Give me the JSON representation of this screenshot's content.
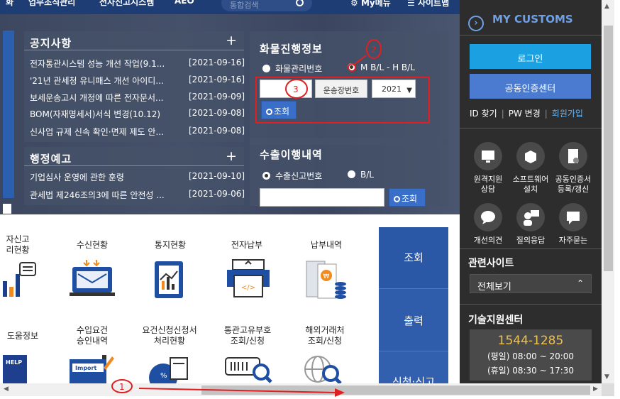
{
  "topnav": {
    "item1": "화",
    "item2": "업무조직관리",
    "item3": "전자신고시스템",
    "item4": "AEO",
    "search_placeholder": "통합검색",
    "mymenu": "My메뉴",
    "sitemap": "사이트맵"
  },
  "notice": {
    "title": "공지사항",
    "items": [
      {
        "title": "전자통관시스템 성능 개선 작업(9.1...",
        "date": "[2021-09-16]"
      },
      {
        "title": "'21년 관세청 유니패스 개선 아이디...",
        "date": "[2021-09-16]"
      },
      {
        "title": "보세운송고시 개정에 따른 전자문서...",
        "date": "[2021-09-09]"
      },
      {
        "title": "BOM(자재명세서)서식 변경(10.12)",
        "date": "[2021-09-08]"
      },
      {
        "title": "신사업 규제 신속 확인·면제 제도 안...",
        "date": "[2021-09-08]"
      }
    ]
  },
  "admin": {
    "title": "행정예고",
    "items": [
      {
        "title": "기업심사 운영에 관한 훈령",
        "date": "[2021-09-10]"
      },
      {
        "title": "관세법 제246조의3에 따른 안전성 ...",
        "date": "[2021-09-06]"
      }
    ]
  },
  "cargo": {
    "title": "화물진행정보",
    "radio1": "화물관리번호",
    "radio2": "M B/L - H B/L",
    "carrier_label": "운송장번호",
    "year_value": "2021",
    "search_label": "조회"
  },
  "export": {
    "title": "수출이행내역",
    "radio1": "수출신고번호",
    "radio2": "B/L",
    "search_label": "조회"
  },
  "services": {
    "row1": [
      {
        "label": "자신고\n리현황",
        "icon": "chart-chat-icon"
      },
      {
        "label": "수신현황",
        "icon": "mail-monitor-icon"
      },
      {
        "label": "통지현황",
        "icon": "report-chart-icon"
      },
      {
        "label": "전자납부",
        "icon": "payment-terminal-icon"
      },
      {
        "label": "납부내역",
        "icon": "receipt-coins-icon"
      }
    ],
    "row2": [
      {
        "label": "도움정보",
        "icon": "help-book-icon"
      },
      {
        "label": "수입요건\n승인내역",
        "icon": "import-document-icon"
      },
      {
        "label": "요건신청신청서\n처리현황",
        "icon": "percent-document-icon"
      },
      {
        "label": "통관고유부호\n조회/신청",
        "icon": "barcode-search-icon"
      },
      {
        "label": "해외거래처\n조회/신청",
        "icon": "globe-search-icon"
      }
    ],
    "help_text": "HELP",
    "import_text": "Import"
  },
  "tabs": [
    "조회",
    "출력",
    "신청·신고"
  ],
  "sidebar": {
    "title": "MY CUSTOMS",
    "login": "로그인",
    "cert_center": "공동인증센터",
    "find_id": "ID 찾기",
    "change_pw": "PW 변경",
    "join": "회원가입",
    "quick": [
      {
        "label": "원격지원\n상담",
        "icon": "remote-support-icon"
      },
      {
        "label": "소프트웨어\n설치",
        "icon": "software-box-icon"
      },
      {
        "label": "공동인증서\n등록/갱신",
        "icon": "certificate-icon"
      },
      {
        "label": "개선의견",
        "icon": "speech-bubble-icon"
      },
      {
        "label": "질의응답",
        "icon": "qa-person-icon"
      },
      {
        "label": "자주묻는",
        "icon": "faq-chat-icon"
      }
    ],
    "related_title": "관련사이트",
    "related_select": "전체보기",
    "support_title": "기술지원센터",
    "support_phone": "1544-1285",
    "hours_weekday": "(평일) 08:00 ~ 20:00",
    "hours_holiday": "(휴일) 08:30 ~ 17:30"
  },
  "annotations": {
    "marker1": "1",
    "marker2": "2",
    "marker3": "3",
    "color": "#e02020"
  }
}
